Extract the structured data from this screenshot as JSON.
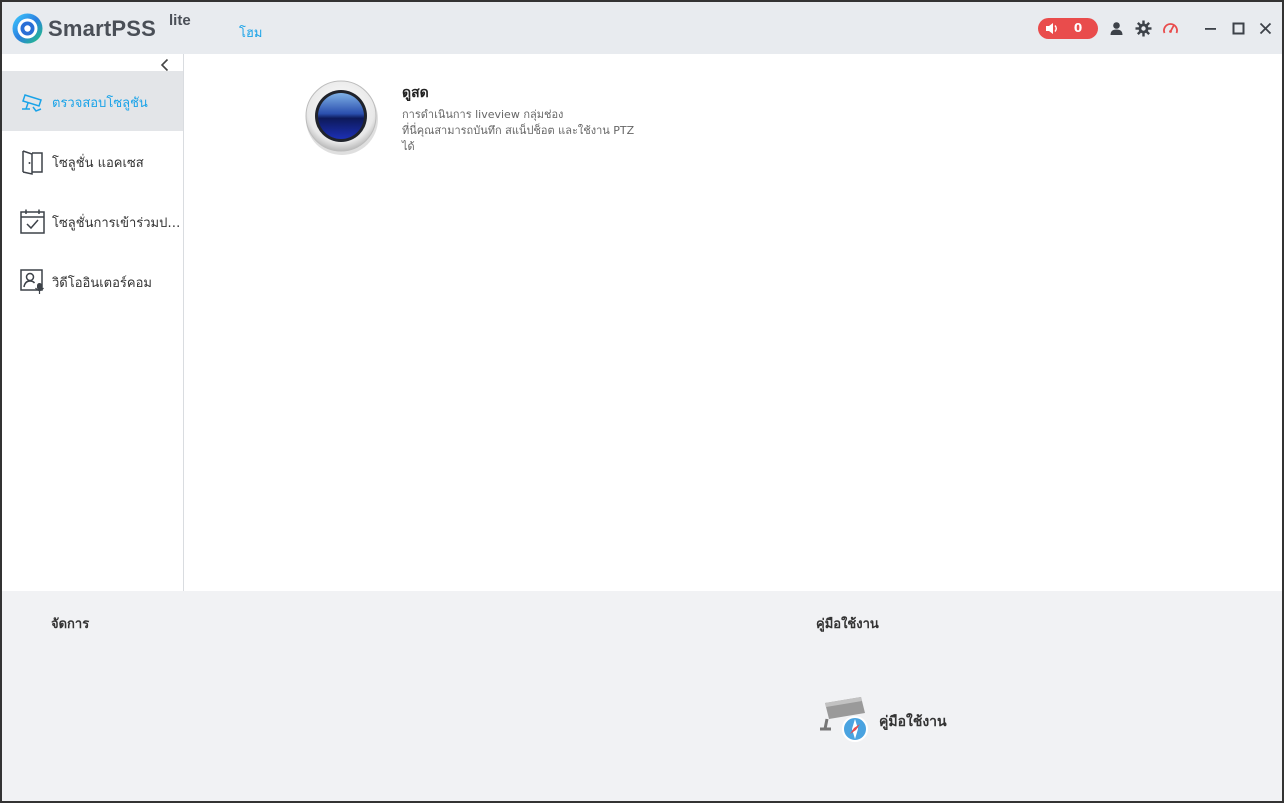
{
  "app": {
    "brand": "SmartPSS",
    "brand_suffix": "lite",
    "home_tab": "โฮม",
    "alarm_count": "0",
    "accent_color": "#1aa3e8",
    "alarm_color": "#e94c4c"
  },
  "titlebar": {
    "icons": [
      "speaker-icon",
      "user-icon",
      "gear-icon",
      "performance-gauge-icon",
      "minimize-icon",
      "maximize-icon",
      "close-icon"
    ]
  },
  "sidebar": {
    "items": [
      {
        "label": "ตรวจสอบโซลูชัน",
        "icon": "surveillance-camera-icon",
        "active": true
      },
      {
        "label": "โซลูชั่น แอคเซส",
        "icon": "door-icon",
        "active": false
      },
      {
        "label": "โซลูชั่นการเข้าร่วมปร...",
        "icon": "calendar-check-icon",
        "active": false
      },
      {
        "label": "วิดีโออินเตอร์คอม",
        "icon": "intercom-icon",
        "active": false
      }
    ]
  },
  "main": {
    "live": {
      "title": "ดูสด",
      "desc_line1": "การดำเนินการ liveview กลุ่มช่อง",
      "desc_line2": "ที่นี่คุณสามารถบันทึก สแน็ปช็อต และใช้งาน PTZ",
      "desc_line3": "ได้"
    }
  },
  "bottom": {
    "manage_title": "จัดการ",
    "manual_title": "คู่มือใช้งาน",
    "manual_item": "คู่มือใช้งาน"
  }
}
